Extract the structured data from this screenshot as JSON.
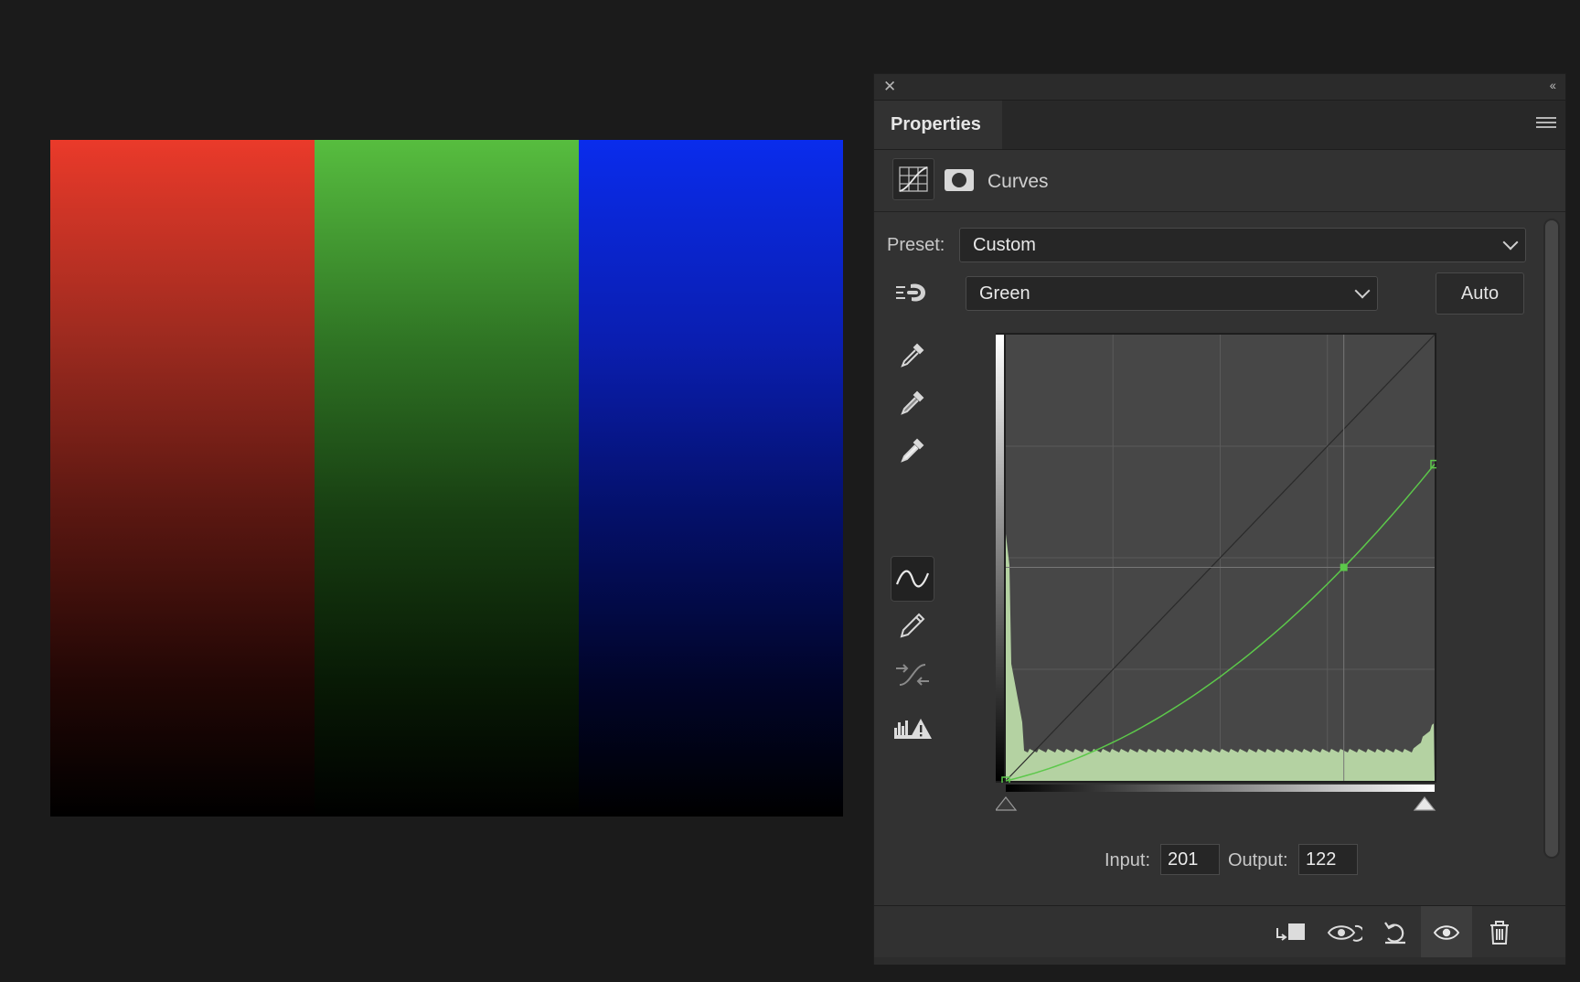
{
  "canvas": {
    "bands": [
      {
        "name": "red",
        "color": "#ea3a2a"
      },
      {
        "name": "green",
        "color": "#57bd3f"
      },
      {
        "name": "blue",
        "color": "#0a2cec"
      }
    ]
  },
  "panel": {
    "tab_title": "Properties",
    "adjustment_title": "Curves",
    "preset_label": "Preset:",
    "preset_value": "Custom",
    "channel_value": "Green",
    "auto_label": "Auto",
    "input_label": "Input:",
    "input_value": "201",
    "output_label": "Output:",
    "output_value": "122",
    "tools": [
      {
        "name": "sample-black-point-icon"
      },
      {
        "name": "sample-gray-point-icon"
      },
      {
        "name": "sample-white-point-icon"
      },
      {
        "name": "edit-points-curve-icon",
        "active": true
      },
      {
        "name": "draw-curve-pencil-icon"
      },
      {
        "name": "smooth-curve-icon"
      },
      {
        "name": "clipping-warning-icon"
      }
    ],
    "bottom_buttons": [
      {
        "name": "clip-to-layer-icon"
      },
      {
        "name": "view-previous-state-icon"
      },
      {
        "name": "reset-adjustment-icon"
      },
      {
        "name": "toggle-visibility-icon",
        "active": true
      },
      {
        "name": "delete-adjustment-icon"
      }
    ]
  },
  "curve": {
    "channel_color": "#5cc84a",
    "points": [
      [
        0,
        0
      ],
      [
        201,
        122
      ],
      [
        255,
        181
      ]
    ],
    "selected_point_index": 1,
    "histogram_color": "#b4d2a2"
  }
}
